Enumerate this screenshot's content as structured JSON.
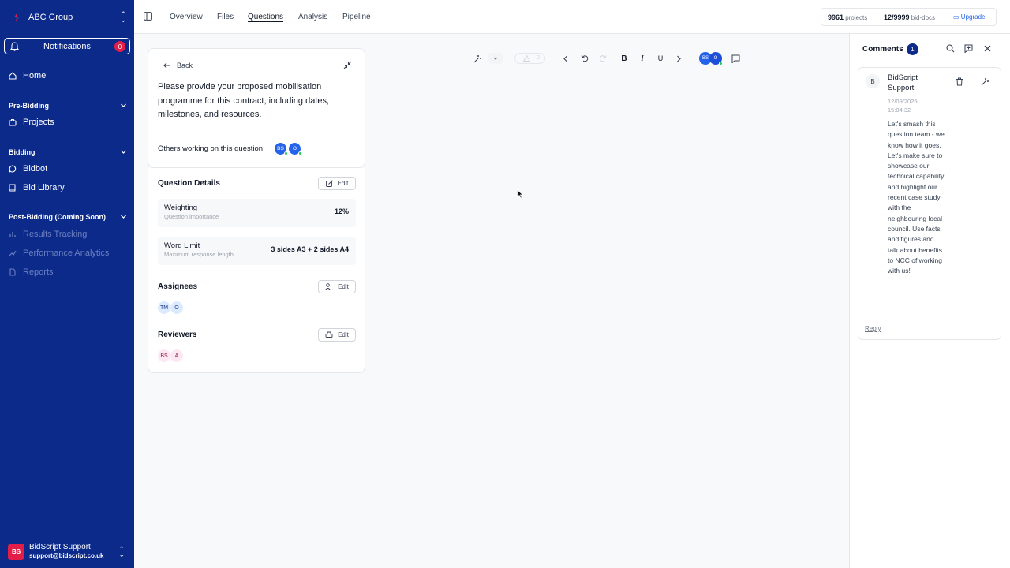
{
  "sidebar": {
    "org_name": "ABC Group",
    "notifications_label": "Notifications",
    "notifications_count": "0",
    "home": "Home",
    "sections": {
      "pre_bidding": "Pre-Bidding",
      "bidding": "Bidding",
      "post_bidding": "Post-Bidding (Coming Soon)"
    },
    "projects": "Projects",
    "bidbot": "Bidbot",
    "bid_library": "Bid Library",
    "results_tracking": "Results Tracking",
    "performance_analytics": "Performance Analytics",
    "reports": "Reports",
    "user": {
      "initials": "BS",
      "name": "BidScript Support",
      "email": "support@bidscript.co.uk"
    }
  },
  "topbar": {
    "tabs": [
      "Overview",
      "Files",
      "Questions",
      "Analysis",
      "Pipeline"
    ],
    "active_tab": "Questions",
    "projects_count": "9961",
    "projects_label": "projects",
    "bid_docs_count": "12/9999",
    "bid_docs_label": "bid-docs",
    "upgrade": "Upgrade"
  },
  "question": {
    "back": "Back",
    "text": "Please provide your proposed mobilisation programme for this contract, including dates, milestones, and resources.",
    "others_label": "Others working on this question:",
    "others": [
      "BS",
      "O"
    ],
    "details_title": "Question Details",
    "edit_label": "Edit",
    "weighting_label": "Weighting",
    "weighting_sub": "Question importance",
    "weighting_value": "12%",
    "word_limit_label": "Word Limit",
    "word_limit_sub": "Maximum response length",
    "word_limit_value": "3 sides A3 + 2 sides A4",
    "assignees_title": "Assignees",
    "assignees": [
      "TM",
      "O"
    ],
    "reviewers_title": "Reviewers",
    "reviewers": [
      "BS",
      "A"
    ]
  },
  "editor_toolbar": {
    "warnings_count": "0",
    "collaborators": [
      "BS",
      "O"
    ]
  },
  "comments": {
    "title": "Comments",
    "count": "1",
    "items": [
      {
        "avatar": "B",
        "author": "BidScript Support",
        "date": "12/09/2025, 15:04:32",
        "body": "Let's smash this question team - we know how it goes. Let's make sure to showcase our technical capability and highlight our recent case study with the neighbouring local council. Use facts and figures and talk about benefits to NCC of working with us!",
        "reply": "Reply"
      }
    ]
  },
  "colors": {
    "sidebar_bg": "#0b2a8a",
    "badge": "#e11d48",
    "accent": "#2563eb",
    "online": "#22c55e"
  }
}
